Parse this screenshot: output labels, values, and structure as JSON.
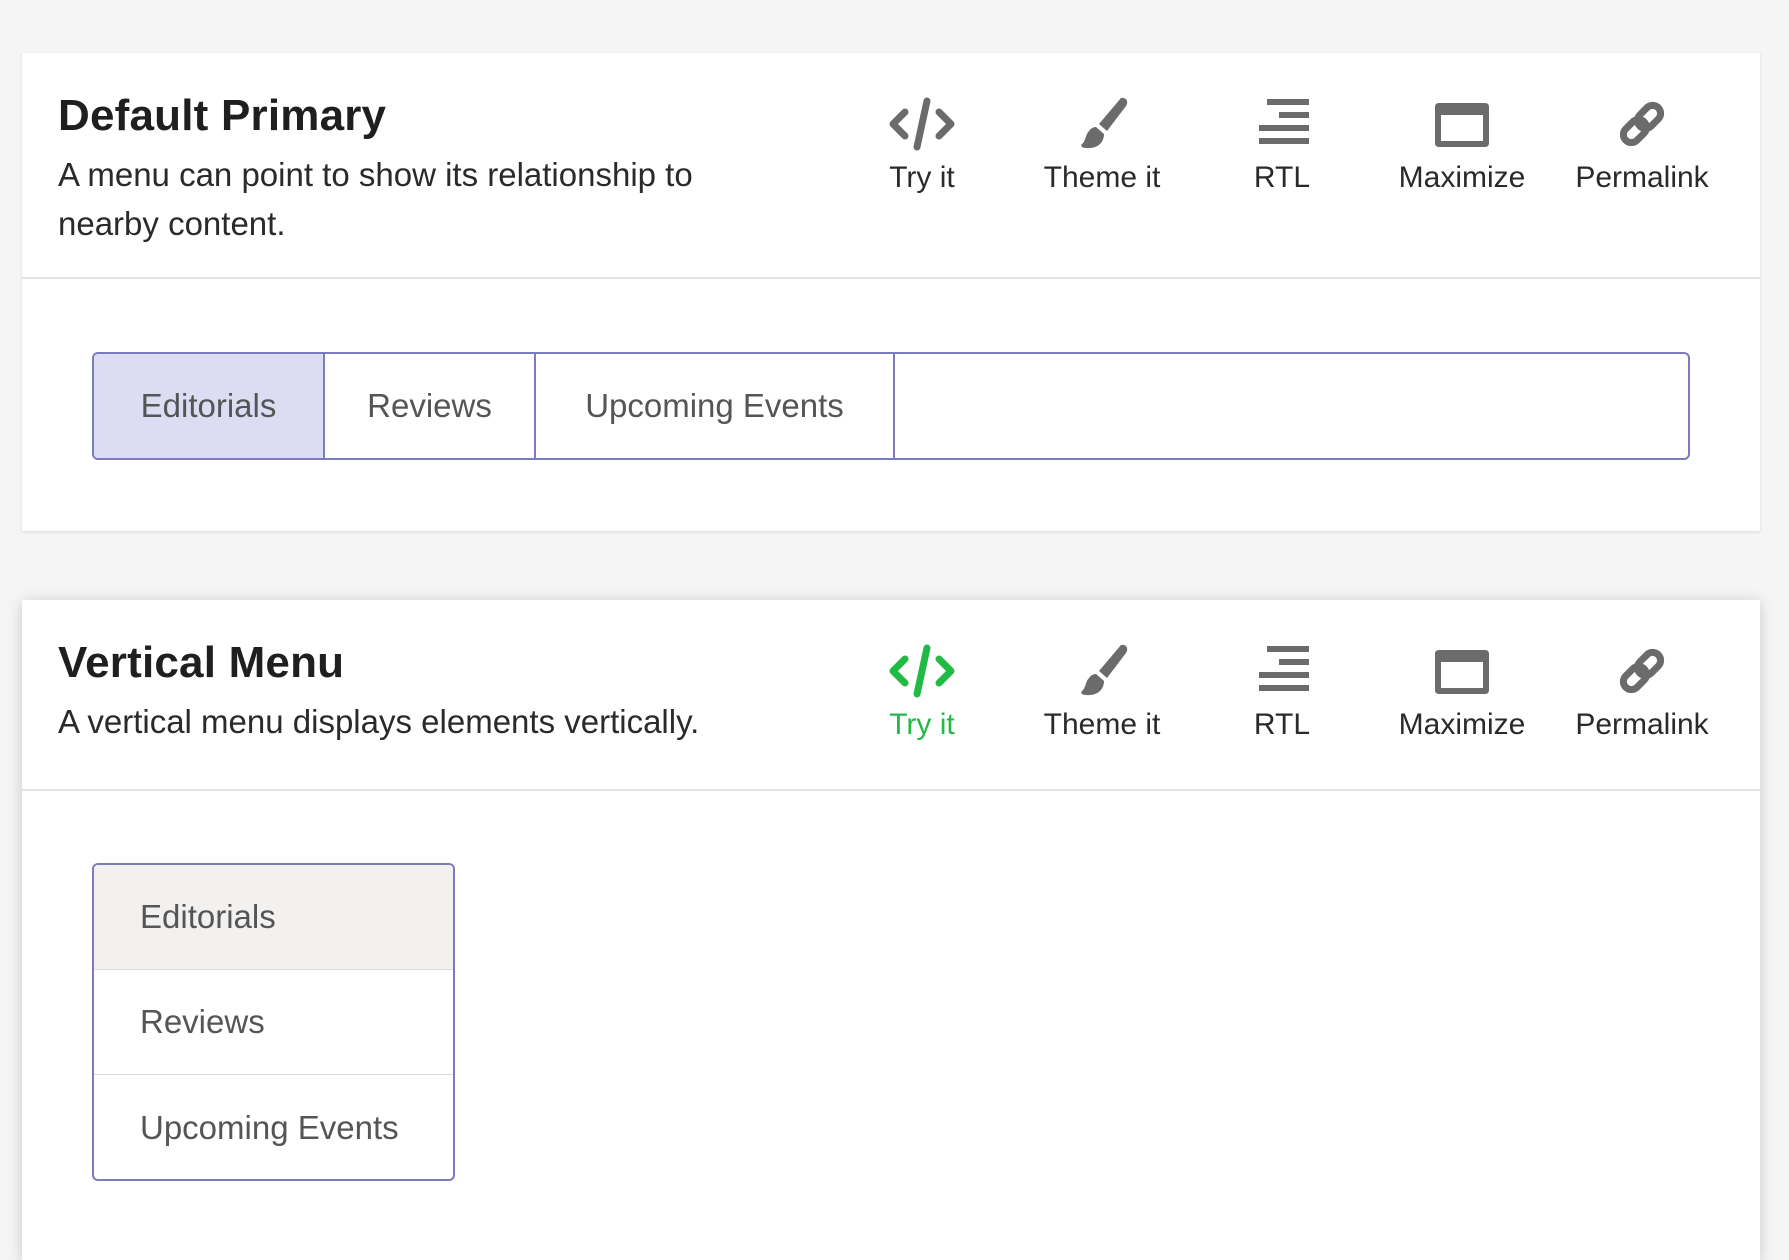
{
  "sections": [
    {
      "title": "Default Primary",
      "description": "A menu can point to show its relationship to nearby content.",
      "tools": [
        {
          "label": "Try it",
          "icon": "code-icon",
          "active": false
        },
        {
          "label": "Theme it",
          "icon": "paintbrush-icon",
          "active": false
        },
        {
          "label": "RTL",
          "icon": "align-right-icon",
          "active": false
        },
        {
          "label": "Maximize",
          "icon": "window-maximize-icon",
          "active": false
        },
        {
          "label": "Permalink",
          "icon": "link-icon",
          "active": false
        }
      ],
      "menu": {
        "orientation": "horizontal",
        "items": [
          "Editorials",
          "Reviews",
          "Upcoming Events"
        ],
        "active_index": 0
      }
    },
    {
      "title": "Vertical Menu",
      "description": "A vertical menu displays elements vertically.",
      "tools": [
        {
          "label": "Try it",
          "icon": "code-icon",
          "active": true
        },
        {
          "label": "Theme it",
          "icon": "paintbrush-icon",
          "active": false
        },
        {
          "label": "RTL",
          "icon": "align-right-icon",
          "active": false
        },
        {
          "label": "Maximize",
          "icon": "window-maximize-icon",
          "active": false
        },
        {
          "label": "Permalink",
          "icon": "link-icon",
          "active": false
        }
      ],
      "menu": {
        "orientation": "vertical",
        "items": [
          "Editorials",
          "Reviews",
          "Upcoming Events"
        ],
        "active_index": 0
      }
    }
  ],
  "colors": {
    "icon": "#6b6b6b",
    "active_tool": "#21ba45",
    "menu_border": "#7b7bbf",
    "horizontal_active_bg": "#dcdcf3",
    "vertical_active_bg": "#f2f1f0"
  }
}
